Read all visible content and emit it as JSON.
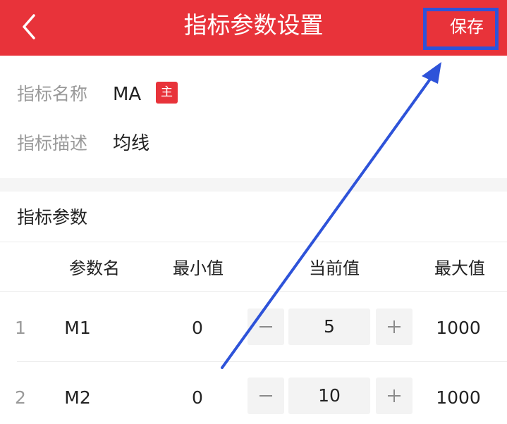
{
  "header": {
    "title": "指标参数设置",
    "save_label": "保存",
    "back_icon": "chevron-left-icon"
  },
  "info": {
    "name_label": "指标名称",
    "name_value": "MA",
    "badge": "主",
    "desc_label": "指标描述",
    "desc_value": "均线"
  },
  "params": {
    "section_title": "指标参数",
    "columns": [
      "参数名",
      "最小值",
      "当前值",
      "最大值"
    ],
    "rows": [
      {
        "index": "1",
        "name": "M1",
        "min": "0",
        "current": "5",
        "max": "1000"
      },
      {
        "index": "2",
        "name": "M2",
        "min": "0",
        "current": "10",
        "max": "1000"
      }
    ]
  },
  "colors": {
    "header_bg": "#e8333a",
    "highlight": "#2e53d9",
    "annotation_arrow": "#2e53d9"
  }
}
